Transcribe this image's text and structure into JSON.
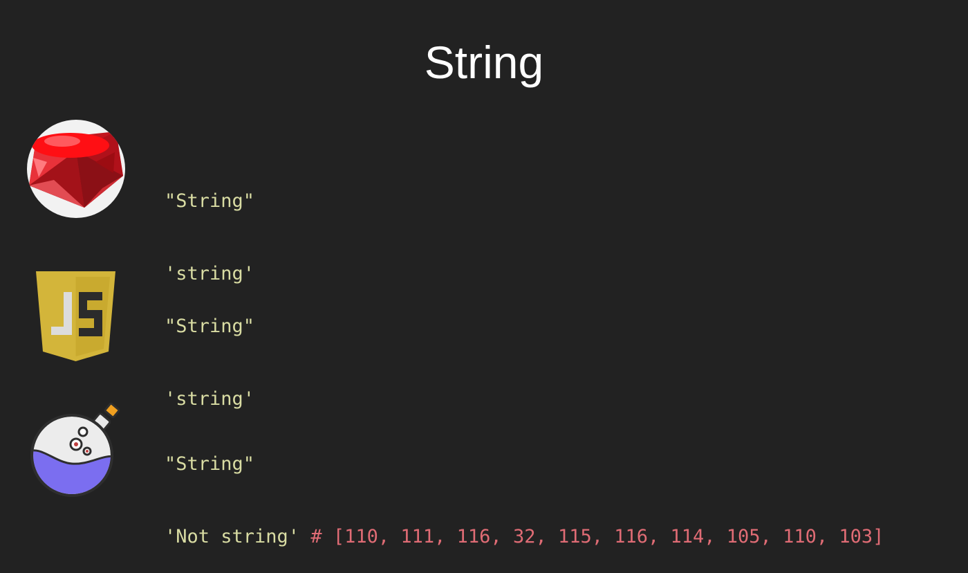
{
  "slide": {
    "title": "String",
    "colors": {
      "background": "#222222",
      "string": "#d9dca3",
      "comment": "#e06c75"
    }
  },
  "rows": [
    {
      "logo": "ruby-icon",
      "lines": [
        {
          "code": "\"String\""
        },
        {
          "code": "'string'"
        }
      ]
    },
    {
      "logo": "javascript-icon",
      "lines": [
        {
          "code": "\"String\""
        },
        {
          "code": "'string'"
        }
      ]
    },
    {
      "logo": "elixir-potion-icon",
      "lines": [
        {
          "code": "\"String\""
        },
        {
          "code": "'Not string'",
          "comment": "# [110, 111, 116, 32, 115, 116, 114, 105, 110, 103]"
        }
      ]
    }
  ]
}
